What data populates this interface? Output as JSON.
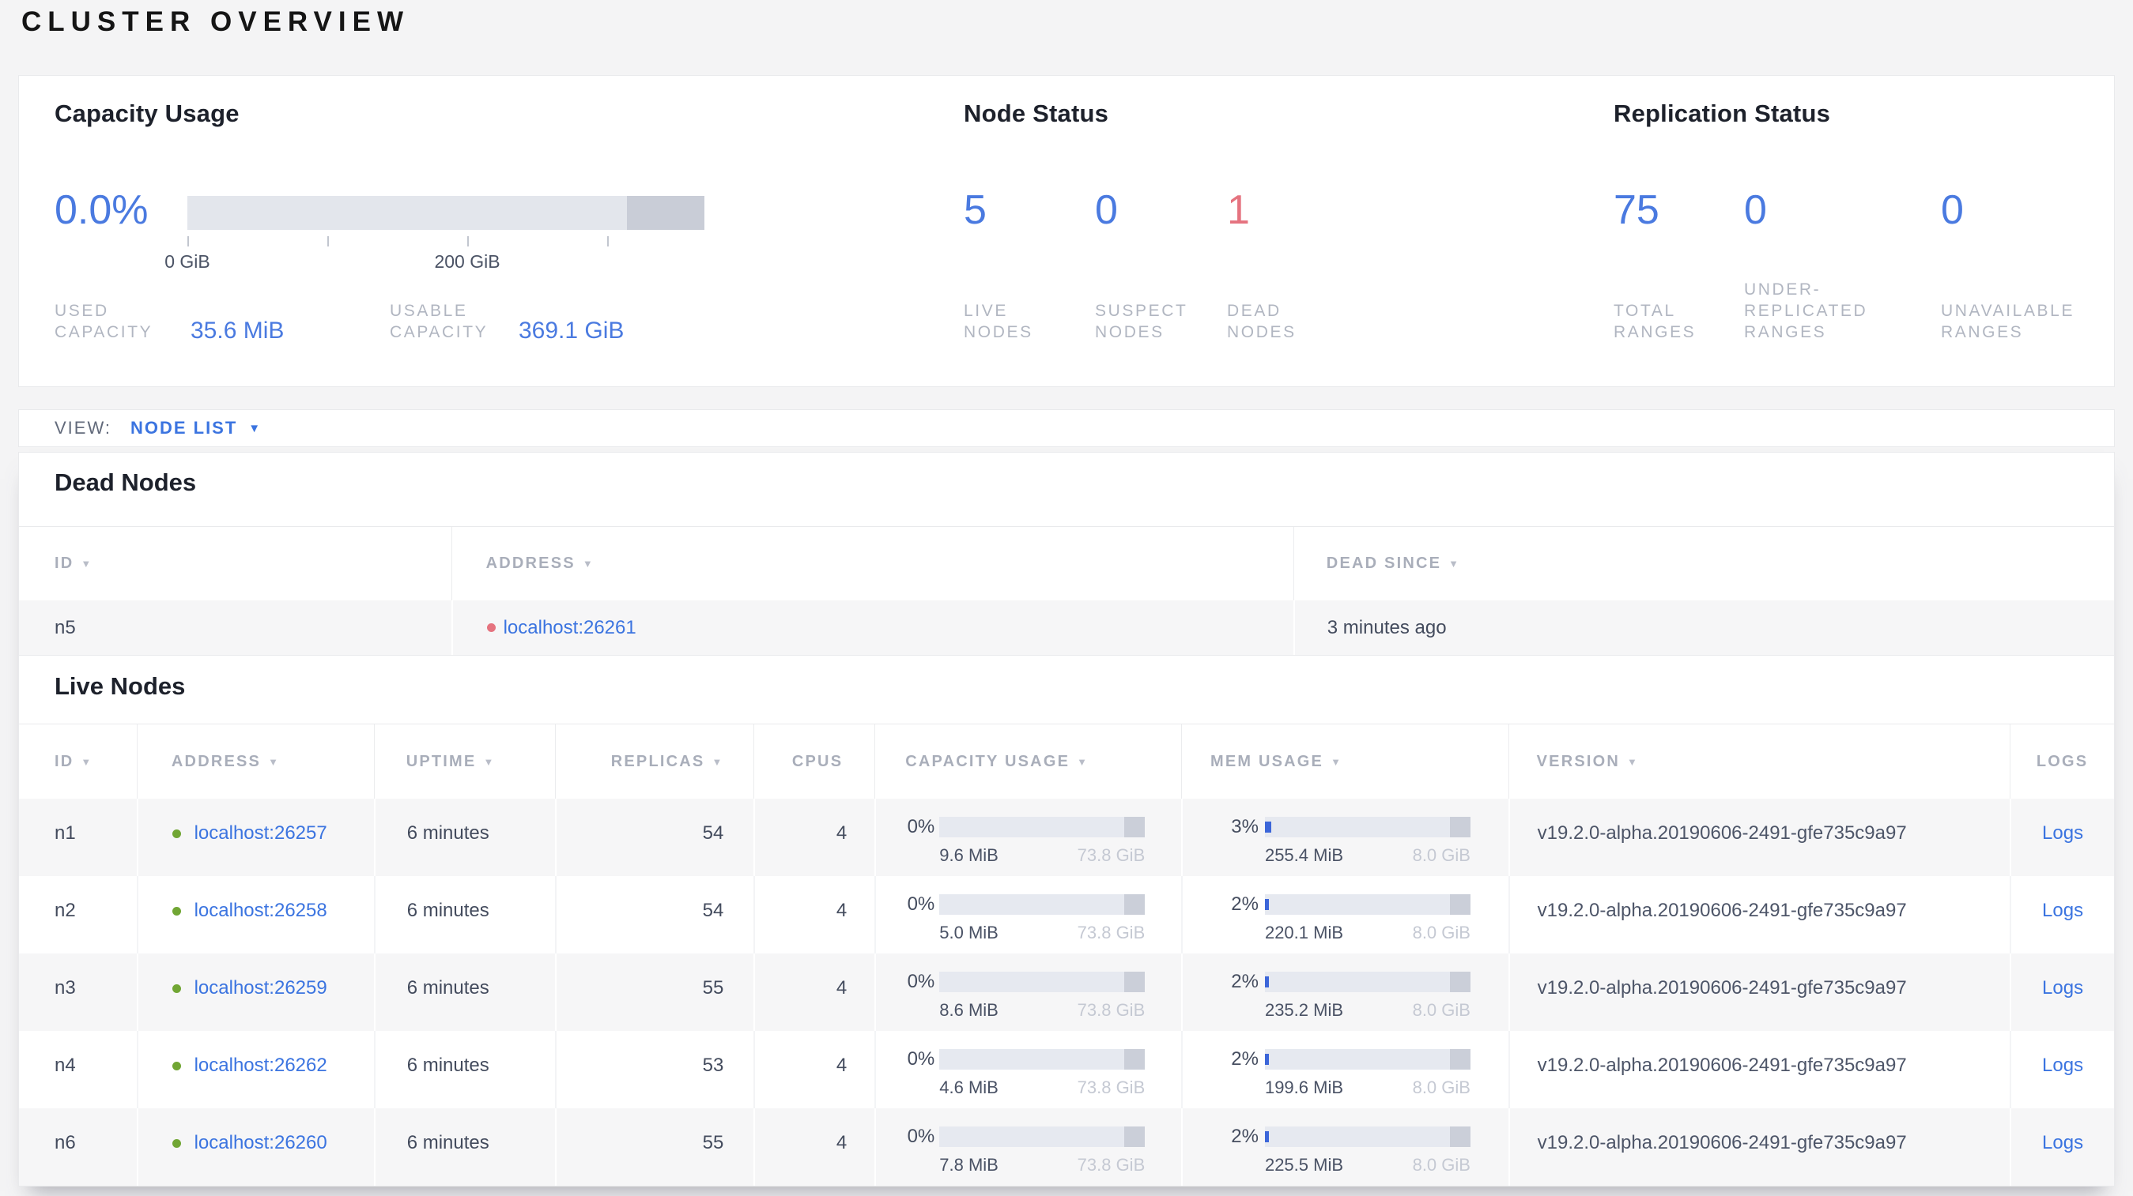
{
  "page_title": "CLUSTER OVERVIEW",
  "colors": {
    "accent_blue": "#4a7ae0",
    "link_blue": "#3b74e0",
    "danger_pink": "#e5737f",
    "live_green": "#71a634",
    "label_gray": "#b1b6c1",
    "bar_track": "#e6e9f0",
    "bar_reserved": "#cbcfd9",
    "bar_fill_blue": "#3c66d9"
  },
  "icons": {
    "sort_arrow": "▼",
    "dropdown_caret": "▼"
  },
  "summary": {
    "capacity": {
      "title": "Capacity Usage",
      "percent": "0.0%",
      "tick_labels": [
        "0 GiB",
        "200 GiB"
      ],
      "stats": [
        {
          "label_lines": [
            "USED",
            "CAPACITY"
          ],
          "value": "35.6 MiB"
        },
        {
          "label_lines": [
            "USABLE",
            "CAPACITY"
          ],
          "value": "369.1 GiB"
        }
      ]
    },
    "node_status": {
      "title": "Node Status",
      "stats": [
        {
          "value": "5",
          "label_lines": [
            "LIVE",
            "NODES"
          ]
        },
        {
          "value": "0",
          "label_lines": [
            "SUSPECT",
            "NODES"
          ]
        },
        {
          "value": "1",
          "label_lines": [
            "DEAD",
            "NODES"
          ]
        }
      ]
    },
    "replication": {
      "title": "Replication Status",
      "stats": [
        {
          "value": "75",
          "label_lines": [
            "TOTAL",
            "RANGES"
          ]
        },
        {
          "value": "0",
          "label_lines": [
            "UNDER-",
            "REPLICATED",
            "RANGES"
          ]
        },
        {
          "value": "0",
          "label_lines": [
            "UNAVAILABLE",
            "RANGES"
          ]
        }
      ]
    }
  },
  "view_bar": {
    "label": "VIEW:",
    "selected": "NODE LIST"
  },
  "dead_nodes": {
    "title": "Dead Nodes",
    "columns": [
      "ID",
      "ADDRESS",
      "DEAD SINCE"
    ],
    "rows": [
      {
        "id": "n5",
        "address": "localhost:26261",
        "dead_since": "3 minutes ago"
      }
    ]
  },
  "live_nodes": {
    "title": "Live Nodes",
    "columns": [
      "ID",
      "ADDRESS",
      "UPTIME",
      "REPLICAS",
      "CPUS",
      "CAPACITY USAGE",
      "MEM USAGE",
      "VERSION",
      "LOGS"
    ],
    "rows": [
      {
        "id": "n1",
        "address": "localhost:26257",
        "uptime": "6 minutes",
        "replicas": "54",
        "cpus": "4",
        "capacity": {
          "percent": "0%",
          "fill": 0,
          "used": "9.6 MiB",
          "total": "73.8 GiB"
        },
        "mem": {
          "percent": "3%",
          "fill": 3,
          "used": "255.4 MiB",
          "total": "8.0 GiB"
        },
        "version": "v19.2.0-alpha.20190606-2491-gfe735c9a97",
        "logs": "Logs"
      },
      {
        "id": "n2",
        "address": "localhost:26258",
        "uptime": "6 minutes",
        "replicas": "54",
        "cpus": "4",
        "capacity": {
          "percent": "0%",
          "fill": 0,
          "used": "5.0 MiB",
          "total": "73.8 GiB"
        },
        "mem": {
          "percent": "2%",
          "fill": 2,
          "used": "220.1 MiB",
          "total": "8.0 GiB"
        },
        "version": "v19.2.0-alpha.20190606-2491-gfe735c9a97",
        "logs": "Logs"
      },
      {
        "id": "n3",
        "address": "localhost:26259",
        "uptime": "6 minutes",
        "replicas": "55",
        "cpus": "4",
        "capacity": {
          "percent": "0%",
          "fill": 0,
          "used": "8.6 MiB",
          "total": "73.8 GiB"
        },
        "mem": {
          "percent": "2%",
          "fill": 2,
          "used": "235.2 MiB",
          "total": "8.0 GiB"
        },
        "version": "v19.2.0-alpha.20190606-2491-gfe735c9a97",
        "logs": "Logs"
      },
      {
        "id": "n4",
        "address": "localhost:26262",
        "uptime": "6 minutes",
        "replicas": "53",
        "cpus": "4",
        "capacity": {
          "percent": "0%",
          "fill": 0,
          "used": "4.6 MiB",
          "total": "73.8 GiB"
        },
        "mem": {
          "percent": "2%",
          "fill": 2,
          "used": "199.6 MiB",
          "total": "8.0 GiB"
        },
        "version": "v19.2.0-alpha.20190606-2491-gfe735c9a97",
        "logs": "Logs"
      },
      {
        "id": "n6",
        "address": "localhost:26260",
        "uptime": "6 minutes",
        "replicas": "55",
        "cpus": "4",
        "capacity": {
          "percent": "0%",
          "fill": 0,
          "used": "7.8 MiB",
          "total": "73.8 GiB"
        },
        "mem": {
          "percent": "2%",
          "fill": 2,
          "used": "225.5 MiB",
          "total": "8.0 GiB"
        },
        "version": "v19.2.0-alpha.20190606-2491-gfe735c9a97",
        "logs": "Logs"
      }
    ]
  }
}
